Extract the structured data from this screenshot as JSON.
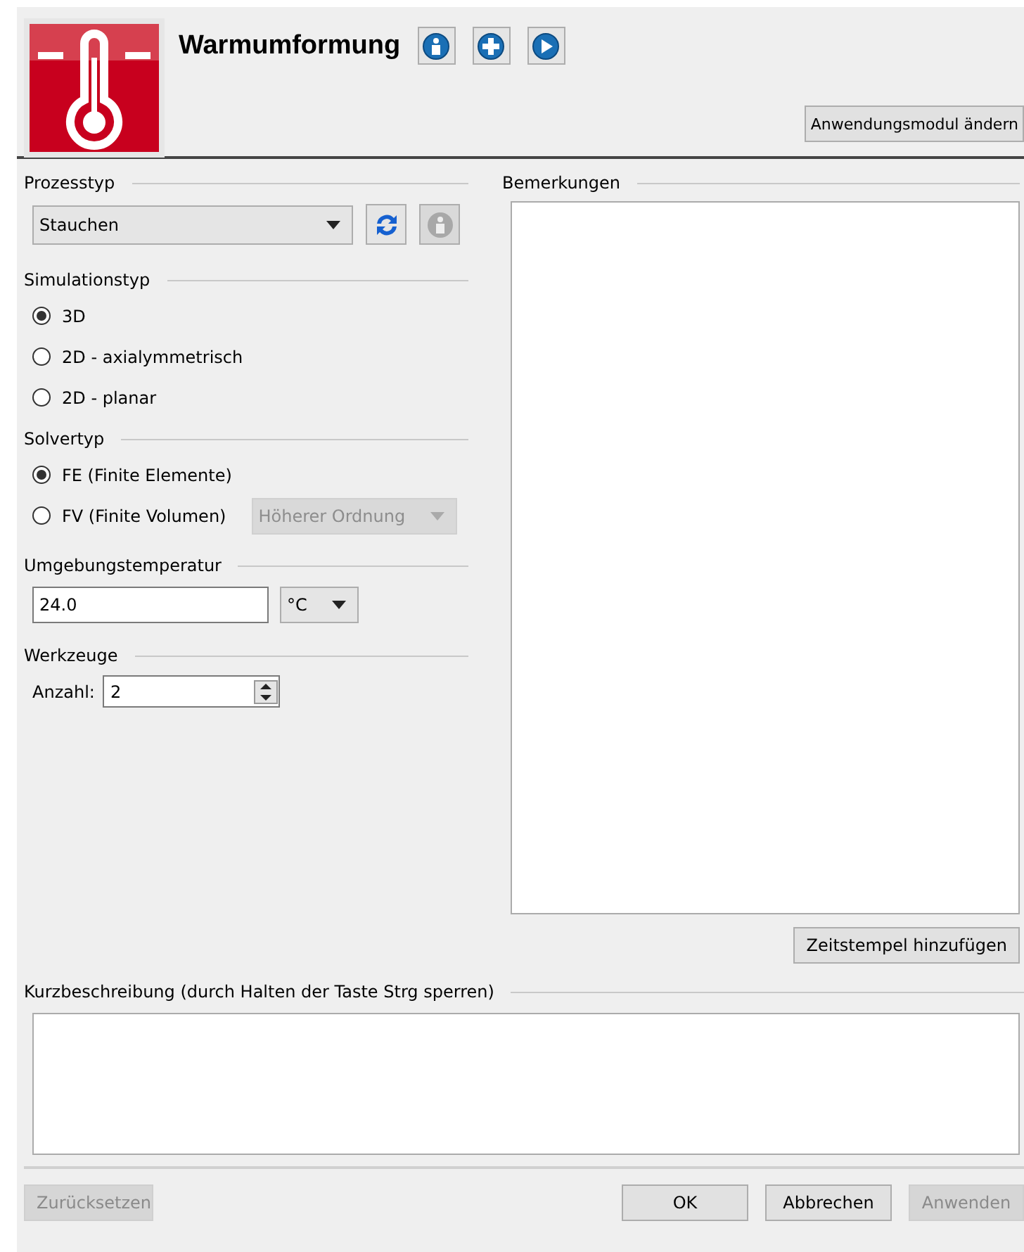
{
  "header": {
    "title": "Warmumformung",
    "change_button": "Anwendungsmodul ändern"
  },
  "process_type": {
    "label": "Prozesstyp",
    "value": "Stauchen",
    "refresh_disabled": false,
    "info_disabled": true
  },
  "simulation_type": {
    "label": "Simulationstyp",
    "options": [
      {
        "label": "3D",
        "selected": true
      },
      {
        "label": "2D - axialymmetrisch",
        "selected": false
      },
      {
        "label": "2D - planar",
        "selected": false
      }
    ]
  },
  "solver_type": {
    "label": "Solvertyp",
    "options": [
      {
        "label": "FE (Finite Elemente)",
        "selected": true
      },
      {
        "label": "FV (Finite Volumen)",
        "selected": false
      }
    ],
    "order": {
      "value": "Höherer Ordnung",
      "disabled": true
    }
  },
  "ambient_temperature": {
    "label": "Umgebungstemperatur",
    "value": "24.0",
    "unit": "°C"
  },
  "tools": {
    "label": "Werkzeuge",
    "count_label": "Anzahl:",
    "count": "2"
  },
  "remarks": {
    "label": "Bemerkungen",
    "timestamp_button": "Zeitstempel hinzufügen"
  },
  "short_description": {
    "label": "Kurzbeschreibung (durch Halten der Taste Strg sperren)"
  },
  "buttons": [
    {
      "label": "Zurücksetzen",
      "disabled": true
    },
    {
      "label": "OK",
      "disabled": false
    },
    {
      "label": "Abbrechen",
      "disabled": false
    },
    {
      "label": "Anwenden",
      "disabled": true
    }
  ]
}
